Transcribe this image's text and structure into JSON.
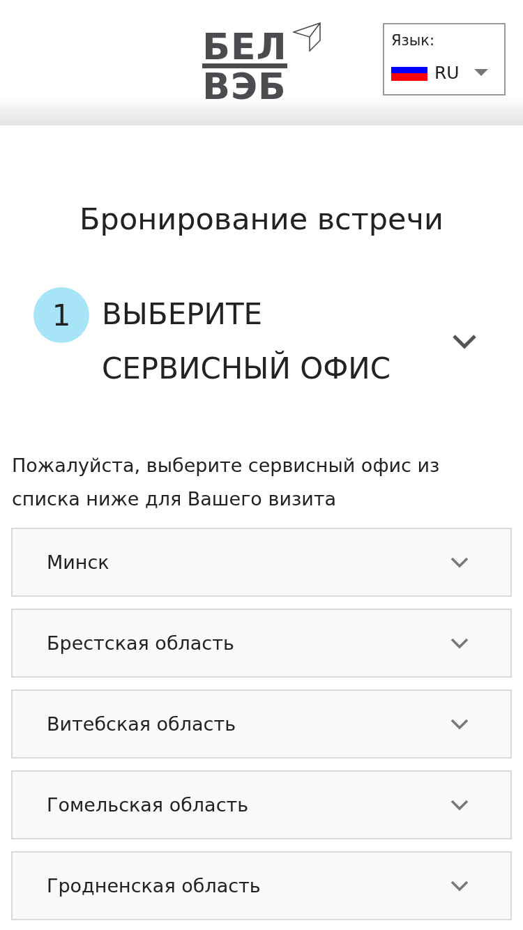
{
  "header": {
    "logo": {
      "line_1": "БЕЛ",
      "line_2": "ВЭБ"
    },
    "language": {
      "label": "Язык:",
      "value": "RU"
    }
  },
  "page_title": "Бронирование встречи",
  "step": {
    "number": "1",
    "title": "ВЫБЕРИТЕ СЕРВИСНЫЙ ОФИС"
  },
  "instruction": "Пожалуйста, выберите сервисный офис из списка ниже для Вашего визита",
  "regions": [
    {
      "label": "Минск",
      "expanded": false
    },
    {
      "label": "Брестская область",
      "expanded": false
    },
    {
      "label": "Витебская область",
      "expanded": false
    },
    {
      "label": "Гомельская область",
      "expanded": false
    },
    {
      "label": "Гродненская область",
      "expanded": false
    }
  ]
}
